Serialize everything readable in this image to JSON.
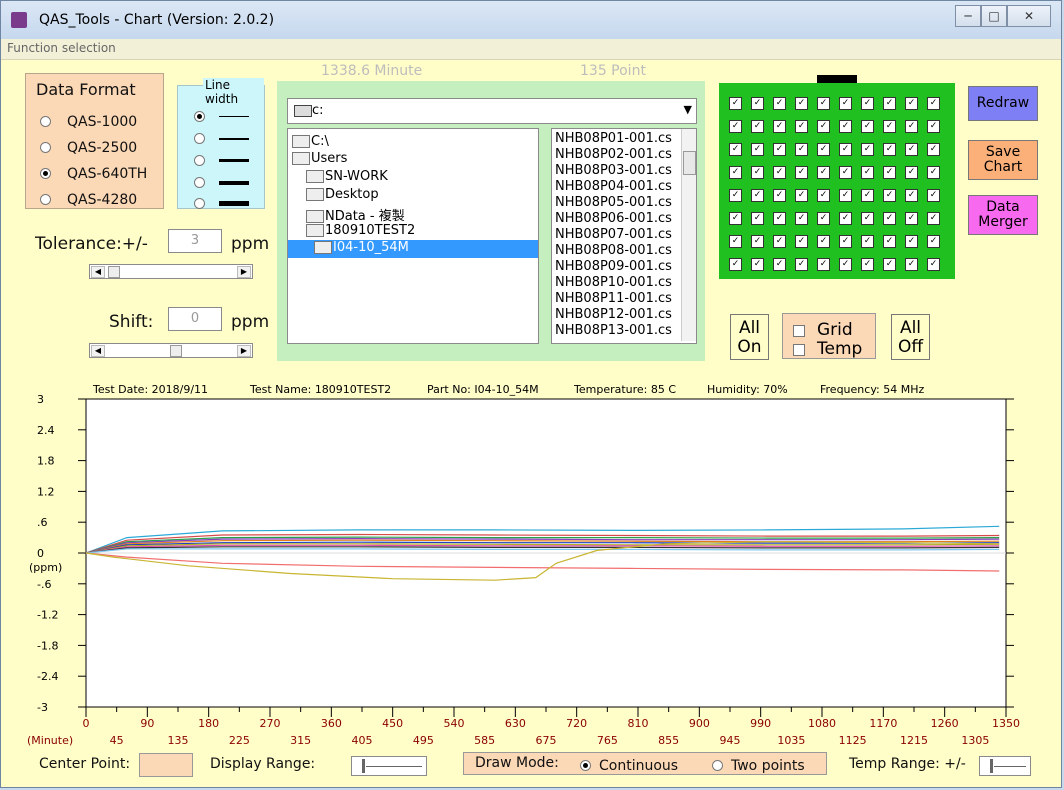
{
  "window": {
    "title": "QAS_Tools - Chart  (Version: 2.0.2)",
    "menu": "Function selection",
    "minimize": "─",
    "maximize": "□",
    "close": "✕"
  },
  "data_format": {
    "title": "Data Format",
    "options": [
      "QAS-1000",
      "QAS-2500",
      "QAS-640TH",
      "QAS-4280"
    ],
    "selected": "QAS-640TH"
  },
  "line_width": {
    "title": "Line width",
    "selected_index": 0
  },
  "tolerance": {
    "label": "Tolerance:+/-",
    "value": "3",
    "unit": "ppm"
  },
  "shift": {
    "label": "Shift:",
    "value": "0",
    "unit": "ppm"
  },
  "header_stats": {
    "minutes": "1338.6  Minute",
    "points": "135  Point"
  },
  "drive": {
    "value": "c:"
  },
  "tree": [
    "C:\\",
    "Users",
    "SN-WORK",
    "Desktop",
    "NData - 複製",
    "180910TEST2",
    "I04-10_54M"
  ],
  "tree_selected": "I04-10_54M",
  "files": [
    "NHB08P01-001.cs",
    "NHB08P02-001.cs",
    "NHB08P03-001.cs",
    "NHB08P04-001.cs",
    "NHB08P05-001.cs",
    "NHB08P06-001.cs",
    "NHB08P07-001.cs",
    "NHB08P08-001.cs",
    "NHB08P09-001.cs",
    "NHB08P10-001.cs",
    "NHB08P11-001.cs",
    "NHB08P12-001.cs",
    "NHB08P13-001.cs"
  ],
  "checkbox_grid": {
    "rows": 8,
    "cols": 10,
    "checked": true,
    "check_mark": "✓"
  },
  "buttons": {
    "redraw": "Redraw",
    "save_chart_1": "Save",
    "save_chart_2": "Chart",
    "data_merger_1": "Data",
    "data_merger_2": "Merger",
    "all_on_1": "All",
    "all_on_2": "On",
    "all_off_1": "All",
    "all_off_2": "Off"
  },
  "toggles": {
    "grid": "Grid",
    "temp": "Temp"
  },
  "chart_info": {
    "test_date": "Test Date: 2018/9/11",
    "test_name": "Test Name: 180910TEST2",
    "part_no": "Part No: I04-10_54M",
    "temperature": "Temperature: 85 C",
    "humidity": "Humidity: 70%",
    "frequency": "Frequency: 54 MHz"
  },
  "chart_data": {
    "type": "line",
    "ylabel": "(ppm)",
    "xlabel": "(Minute)",
    "ylim": [
      -3,
      3
    ],
    "xlim": [
      0,
      1350
    ],
    "y_ticks": [
      "3",
      "2.4",
      "1.8",
      "1.2",
      ".6",
      "0",
      "-.6",
      "-1.2",
      "-1.8",
      "-2.4",
      "-3"
    ],
    "x_ticks_top": [
      "0",
      "90",
      "180",
      "270",
      "360",
      "450",
      "540",
      "630",
      "720",
      "810",
      "900",
      "990",
      "1080",
      "1170",
      "1260",
      "1350"
    ],
    "x_ticks_bottom": [
      "45",
      "135",
      "225",
      "315",
      "405",
      "495",
      "585",
      "675",
      "765",
      "855",
      "945",
      "1035",
      "1125",
      "1215",
      "1305"
    ],
    "grid": false,
    "series": [
      {
        "color": "#2aa9d6",
        "x": [
          0,
          60,
          200,
          400,
          600,
          800,
          1000,
          1200,
          1340
        ],
        "y": [
          0,
          0.3,
          0.43,
          0.45,
          0.45,
          0.44,
          0.45,
          0.47,
          0.52
        ]
      },
      {
        "color": "#d64a4a",
        "x": [
          0,
          60,
          200,
          400,
          600,
          800,
          1000,
          1200,
          1340
        ],
        "y": [
          0,
          0.25,
          0.35,
          0.36,
          0.35,
          0.34,
          0.33,
          0.33,
          0.34
        ]
      },
      {
        "color": "#27a048",
        "x": [
          0,
          60,
          200,
          400,
          600,
          800,
          1000,
          1200,
          1340
        ],
        "y": [
          0,
          0.22,
          0.3,
          0.31,
          0.3,
          0.3,
          0.29,
          0.29,
          0.3
        ]
      },
      {
        "color": "#8a3fbf",
        "x": [
          0,
          60,
          200,
          400,
          600,
          800,
          1000,
          1200,
          1340
        ],
        "y": [
          0,
          0.2,
          0.27,
          0.28,
          0.27,
          0.26,
          0.26,
          0.26,
          0.27
        ]
      },
      {
        "color": "#e0801a",
        "x": [
          0,
          60,
          200,
          400,
          600,
          800,
          1000,
          1200,
          1340
        ],
        "y": [
          0,
          0.18,
          0.24,
          0.25,
          0.24,
          0.23,
          0.22,
          0.22,
          0.23
        ]
      },
      {
        "color": "#1f3fbf",
        "x": [
          0,
          60,
          200,
          400,
          600,
          800,
          1000,
          1200,
          1340
        ],
        "y": [
          0,
          0.16,
          0.2,
          0.21,
          0.2,
          0.2,
          0.19,
          0.19,
          0.2
        ]
      },
      {
        "color": "#b0b020",
        "x": [
          0,
          60,
          200,
          400,
          600,
          800,
          1000,
          1200,
          1340
        ],
        "y": [
          0,
          0.14,
          0.18,
          0.18,
          0.17,
          0.16,
          0.16,
          0.16,
          0.17
        ]
      },
      {
        "color": "#e04bb0",
        "x": [
          0,
          60,
          200,
          400,
          600,
          800,
          1000,
          1200,
          1340
        ],
        "y": [
          0,
          0.12,
          0.15,
          0.15,
          0.14,
          0.14,
          0.13,
          0.13,
          0.14
        ]
      },
      {
        "color": "#333333",
        "x": [
          0,
          60,
          200,
          400,
          600,
          800,
          1000,
          1200,
          1340
        ],
        "y": [
          0,
          0.1,
          0.12,
          0.12,
          0.11,
          0.11,
          0.1,
          0.1,
          0.11
        ]
      },
      {
        "color": "#7fc8f0",
        "x": [
          0,
          60,
          200,
          400,
          600,
          800,
          1000,
          1200,
          1340
        ],
        "y": [
          0,
          0.08,
          0.08,
          0.08,
          0.07,
          0.07,
          0.06,
          0.06,
          0.07
        ]
      },
      {
        "color": "#f26e6e",
        "x": [
          0,
          60,
          200,
          400,
          600,
          800,
          1000,
          1200,
          1340
        ],
        "y": [
          0,
          -0.08,
          -0.2,
          -0.26,
          -0.28,
          -0.3,
          -0.32,
          -0.33,
          -0.35
        ]
      },
      {
        "color": "#c8b531",
        "x": [
          0,
          40,
          150,
          300,
          450,
          600,
          660,
          690,
          750,
          850,
          1000,
          1200,
          1340
        ],
        "y": [
          0,
          -0.08,
          -0.25,
          -0.4,
          -0.5,
          -0.53,
          -0.48,
          -0.2,
          0.05,
          0.18,
          0.22,
          0.2,
          0.18
        ]
      }
    ]
  },
  "bottom": {
    "center_point": "Center Point:",
    "display_range": "Display Range:",
    "draw_mode": "Draw Mode:",
    "continuous": "Continuous",
    "two_points": "Two points",
    "temp_range": "Temp Range: +/-"
  }
}
